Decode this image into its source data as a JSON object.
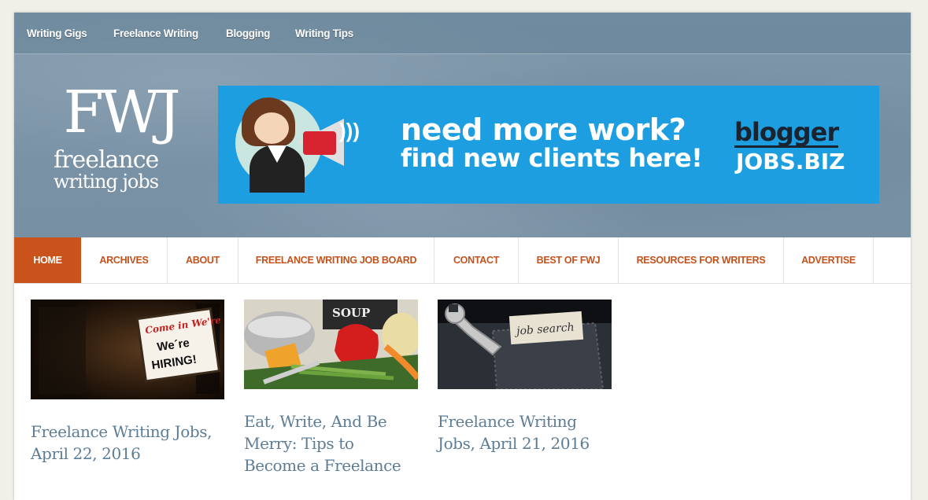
{
  "top_nav": [
    "Writing Gigs",
    "Freelance Writing",
    "Blogging",
    "Writing Tips"
  ],
  "logo": {
    "big": "FWJ",
    "line1": "freelance",
    "line2": "writing jobs"
  },
  "banner": {
    "line1": "need more work?",
    "line2": "find new clients here!",
    "brand_top": "blogger",
    "brand_bottom": "JOBS.BIZ",
    "colors": {
      "bg": "#1c9ee0"
    }
  },
  "main_nav": {
    "items": [
      "HOME",
      "ARCHIVES",
      "ABOUT",
      "FREELANCE WRITING JOB BOARD",
      "CONTACT",
      "BEST OF FWJ",
      "RESOURCES FOR WRITERS",
      "ADVERTISE"
    ],
    "active_index": 0,
    "accent": "#c9531b"
  },
  "posts": [
    {
      "title": "Freelance Writing Jobs, April 22, 2016",
      "image_label": "Come in We're HIRING!"
    },
    {
      "title": "Eat, Write, And Be Merry: Tips to Become a Freelance",
      "image_label": "SOUP"
    },
    {
      "title": "Freelance Writing Jobs, April 21, 2016",
      "image_label": "job search"
    }
  ]
}
